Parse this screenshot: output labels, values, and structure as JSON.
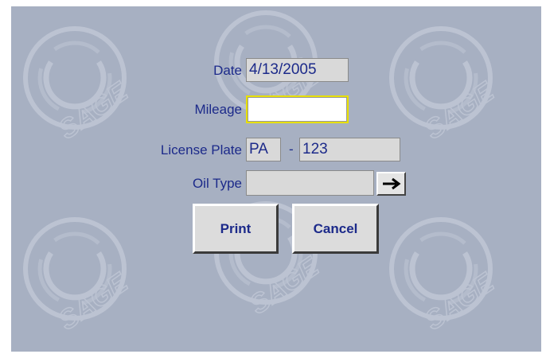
{
  "form": {
    "date_label": "Date",
    "date_value": "4/13/2005",
    "mileage_label": "Mileage",
    "mileage_value": "",
    "license_label": "License Plate",
    "license_state": "PA",
    "license_separator": "-",
    "license_number": "123",
    "oil_label": "Oil Type",
    "oil_value": ""
  },
  "buttons": {
    "print_label": "Print",
    "cancel_label": "Cancel",
    "oil_select_icon": "right-arrow-icon"
  },
  "watermark": {
    "text": "SAGE"
  },
  "colors": {
    "background": "#a7b0c2",
    "label_text": "#1c2a8a",
    "active_border": "#e8e000"
  }
}
